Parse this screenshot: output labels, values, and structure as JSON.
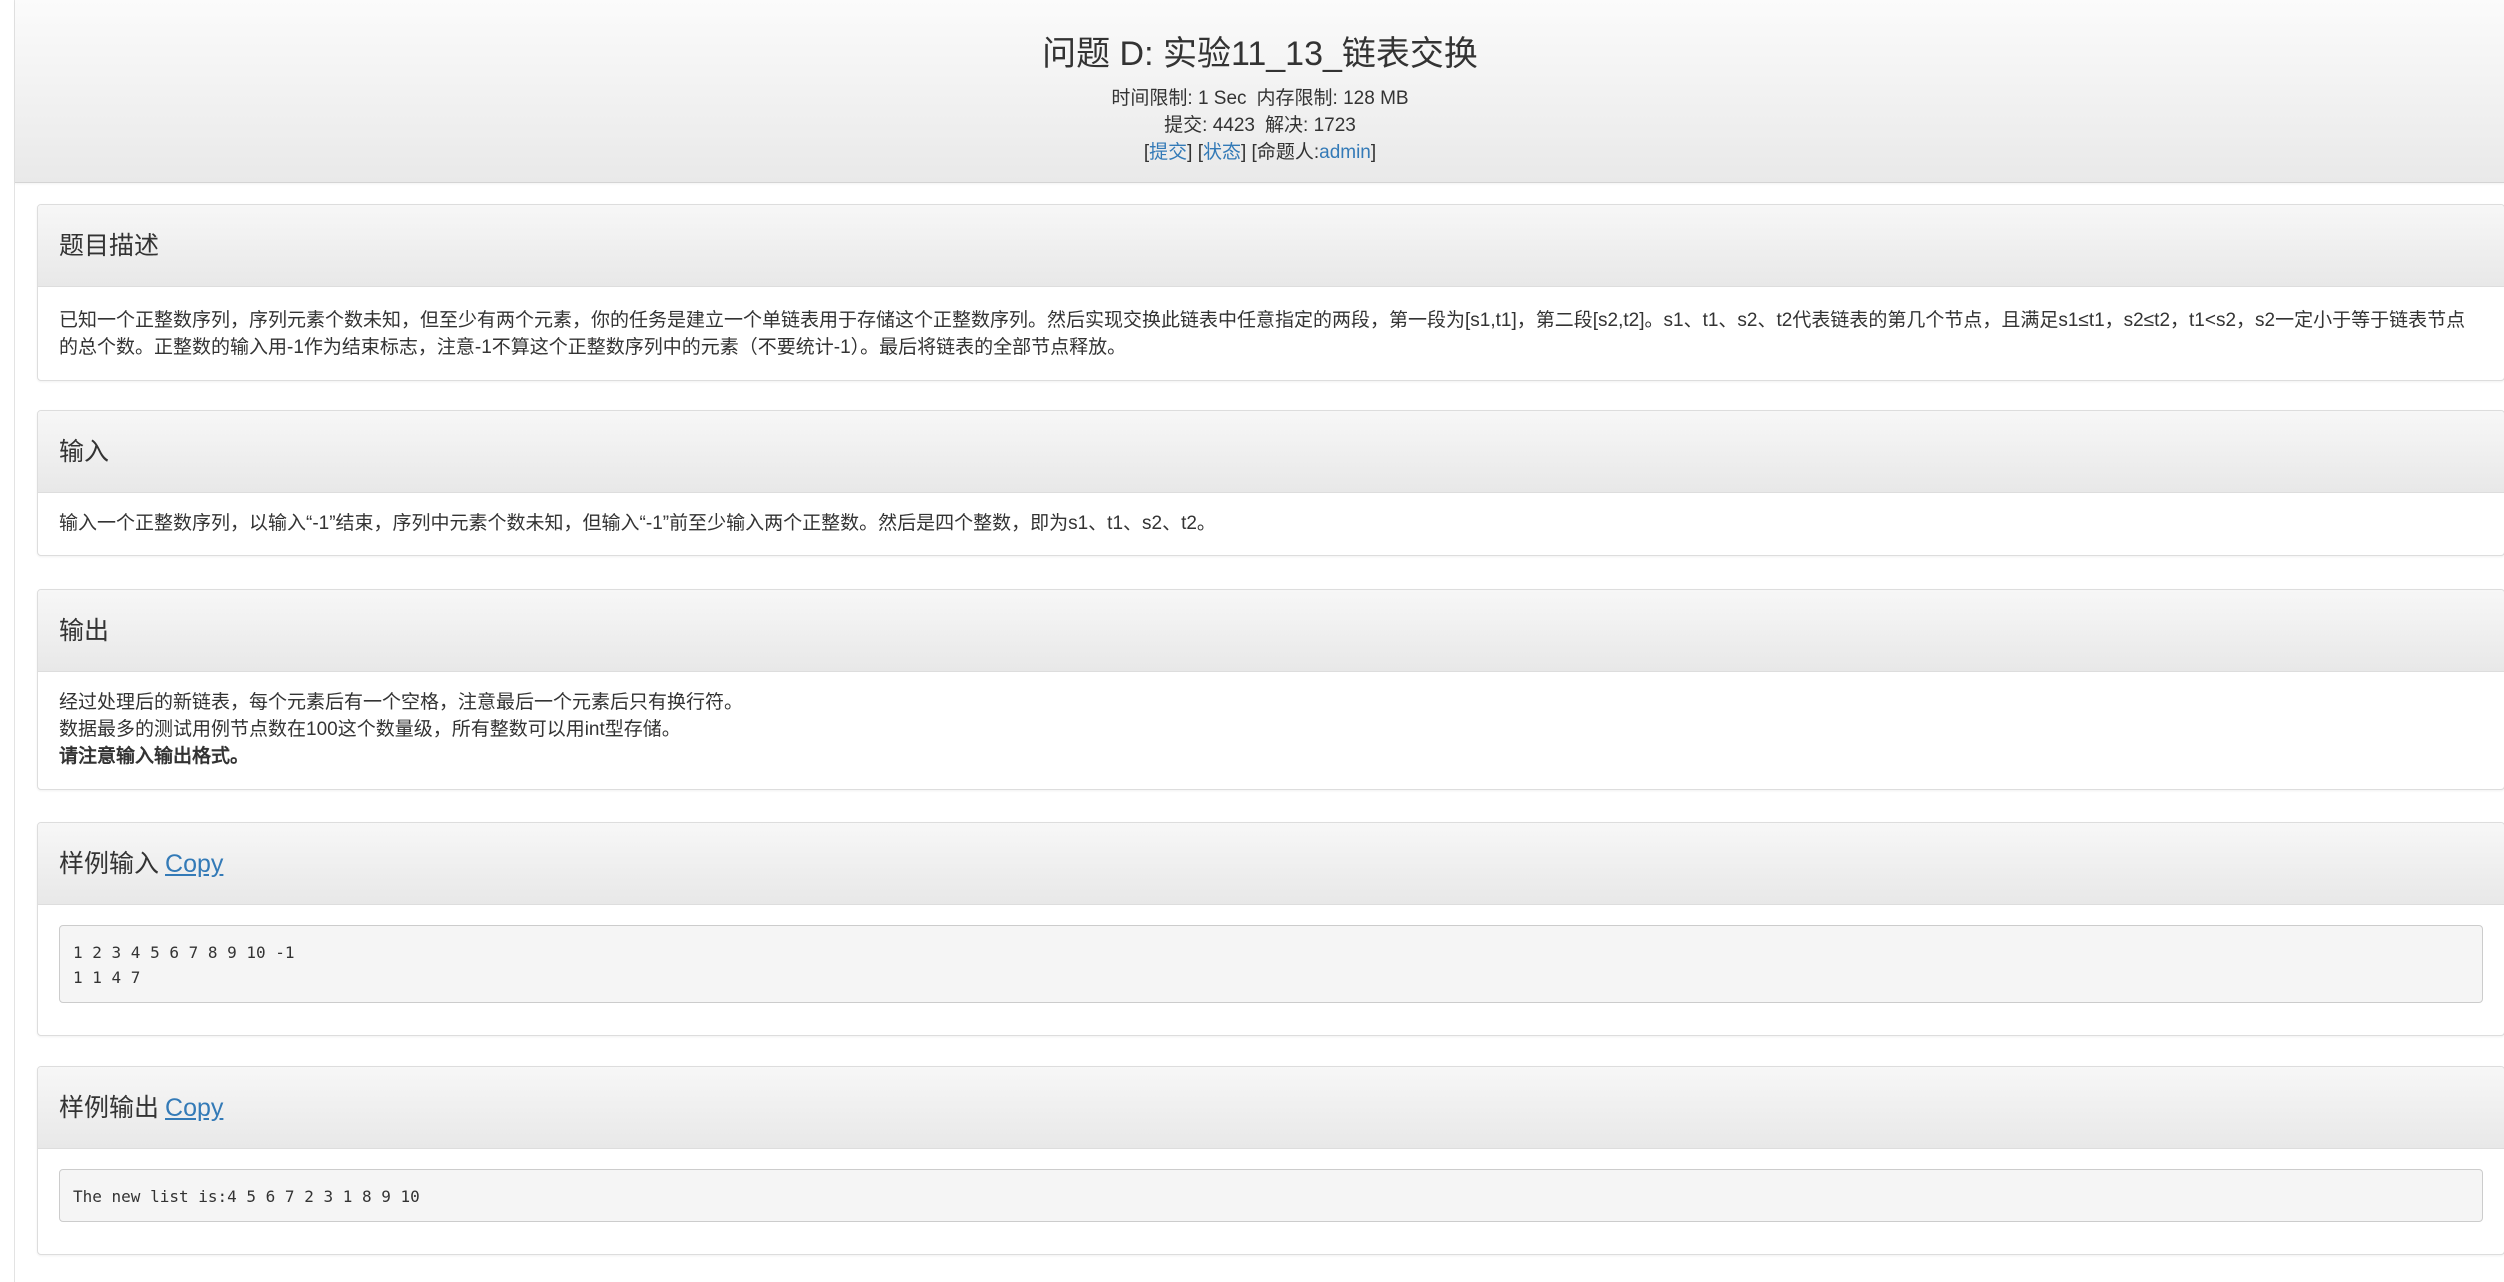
{
  "header": {
    "title": "问题 D: 实验11_13_链表交换",
    "time_limit_label": "时间限制:",
    "time_limit_value": "1 Sec",
    "memory_limit_label": "内存限制:",
    "memory_limit_value": "128 MB",
    "submit_label": "提交:",
    "submit_count": "4423",
    "solved_label": "解决:",
    "solved_count": "1723",
    "links": {
      "submit": "提交",
      "status": "状态",
      "setter_label": "命题人:",
      "setter_name": "admin"
    }
  },
  "sections": {
    "description": {
      "heading": "题目描述",
      "text": "已知一个正整数序列，序列元素个数未知，但至少有两个元素，你的任务是建立一个单链表用于存储这个正整数序列。然后实现交换此链表中任意指定的两段，第一段为[s1,t1]，第二段[s2,t2]。s1、t1、s2、t2代表链表的第几个节点，且满足s1≤t1，s2≤t2，t1<s2，s2一定小于等于链表节点的总个数。正整数的输入用-1作为结束标志，注意-1不算这个正整数序列中的元素（不要统计-1）。最后将链表的全部节点释放。"
    },
    "input": {
      "heading": "输入",
      "text": "输入一个正整数序列，以输入“-1”结束，序列中元素个数未知，但输入“-1”前至少输入两个正整数。然后是四个整数，即为s1、t1、s2、t2。"
    },
    "output": {
      "heading": "输出",
      "line1": "经过处理后的新链表，每个元素后有一个空格，注意最后一个元素后只有换行符。",
      "line2": "数据最多的测试用例节点数在100这个数量级，所有整数可以用int型存储。",
      "line3": "请注意输入输出格式。"
    },
    "sample_input": {
      "heading": "样例输入",
      "copy_label": "Copy",
      "line1": "1 2 3 4 5 6 7 8 9 10 -1",
      "line2": "1 1 4 7"
    },
    "sample_output": {
      "heading": "样例输出",
      "copy_label": "Copy",
      "line1": "The new list is:4 5 6 7 2 3 1 8 9 10"
    }
  }
}
